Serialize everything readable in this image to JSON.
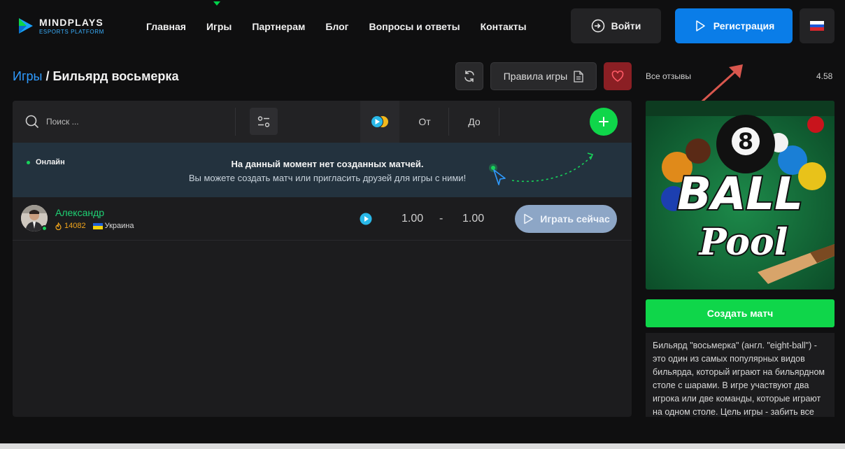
{
  "logo": {
    "title": "MINDPLAYS",
    "subtitle": "ESPORTS PLATFORM"
  },
  "nav": {
    "items": [
      {
        "label": "Главная"
      },
      {
        "label": "Игры"
      },
      {
        "label": "Партнерам"
      },
      {
        "label": "Блог"
      },
      {
        "label": "Вопросы и ответы"
      },
      {
        "label": "Контакты"
      }
    ],
    "active": "Игры"
  },
  "header": {
    "login_label": "Войти",
    "register_label": "Регистрация",
    "language": "ru"
  },
  "breadcrumb": {
    "parent": "Игры",
    "separator": " / ",
    "current": "Бильярд восьмерка"
  },
  "actions": {
    "rules_label": "Правила игры"
  },
  "toolbar": {
    "search_placeholder": "Поиск ...",
    "from_label": "От",
    "to_label": "До"
  },
  "banner": {
    "online_label": "Онлайн",
    "title": "На данный момент нет созданных матчей.",
    "text": "Вы можете создать матч или пригласить друзей для игры с ними!"
  },
  "matches": [
    {
      "player": "Александр",
      "rating": "14082",
      "country": "Украина",
      "bet_from": "1.00",
      "separator": "-",
      "bet_to": "1.00",
      "play_label": "Играть сейчас"
    }
  ],
  "sidebar": {
    "reviews_label": "Все отзывы",
    "reviews_score": "4.58",
    "game_image_text": {
      "number": "8",
      "word1": "BALL",
      "word2": "Pool"
    },
    "create_label": "Создать матч",
    "description": "Бильярд \"восьмерка\" (англ. \"eight-ball\") - это один из самых популярных видов бильярда, который играют на бильярдном столе с шарами. В игре участвуют два игрока или две команды, которые играют на одном столе. Цель игры - забить все"
  },
  "colors": {
    "accent_green": "#0fd64a",
    "accent_blue": "#0a7de8",
    "link_blue": "#2f9bff",
    "player_green": "#1fd074",
    "rating_orange": "#f2a51c",
    "favorite_red": "#8b1f24"
  },
  "icons": {
    "login": "login-icon",
    "register": "play-outline-icon",
    "refresh": "refresh-icon",
    "rules": "document-icon",
    "favorite": "heart-icon",
    "search": "search-icon",
    "filter": "filter-icon",
    "add": "plus-icon",
    "coins": "coins-icon"
  }
}
